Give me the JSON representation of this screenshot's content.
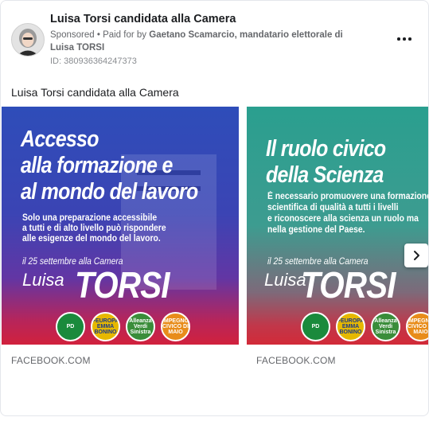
{
  "header": {
    "page_name": "Luisa Torsi candidata alla Camera",
    "sponsored": "Sponsored",
    "paid_for_prefix": "Paid for by",
    "paid_for_by": "Gaetano Scamarcio, mandatario elettorale di Luisa TORSI",
    "ad_id": "ID: 380936364247373"
  },
  "ad_text": "Luisa Torsi candidata alla Camera",
  "carousel": {
    "slides": [
      {
        "headline": [
          "Accesso",
          "alla formazione e",
          "al mondo del lavoro"
        ],
        "subtext": [
          "Solo una preparazione accessibile",
          "a tutti e di alto livello può rispondere",
          "alle esigenze del mondo del lavoro."
        ],
        "date": "il 25 settembre alla Camera",
        "first_name": "Luisa",
        "surname": "TORSI",
        "link_caption": "FACEBOOK.COM"
      },
      {
        "headline": [
          "Il ruolo civico",
          "della Scienza"
        ],
        "subtext": [
          "È necessario promuovere una formazione",
          "scientifica di qualità a tutti i livelli",
          "e riconoscere alla scienza un ruolo ma",
          "nella gestione del Paese."
        ],
        "date": "il 25 settembre alla Camera",
        "first_name": "Luisa",
        "surname": "TORSI",
        "link_caption": "FACEBOOK.COM"
      }
    ],
    "logos": [
      {
        "label": "PD",
        "color": "#1a8a3c"
      },
      {
        "label": "+EUROPA EMMA BONINO",
        "color": "#e6b800"
      },
      {
        "label": "Alleanza Verdi Sinistra",
        "color": "#3a8d3a"
      },
      {
        "label": "IMPEGNO CIVICO DI MAIO",
        "color": "#e88c1a"
      }
    ],
    "next_icon": "chevron-right-icon"
  },
  "icons": {
    "menu": "more-horizontal-icon"
  }
}
